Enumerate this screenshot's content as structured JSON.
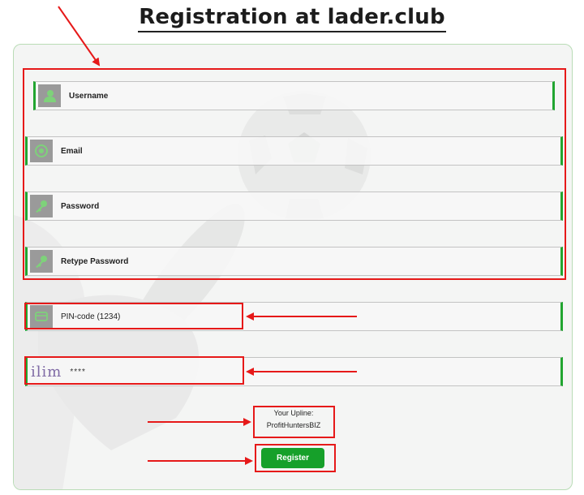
{
  "page": {
    "title": "Registration at lader.club"
  },
  "form": {
    "username": {
      "placeholder": "Username",
      "icon": "user-icon"
    },
    "email": {
      "placeholder": "Email",
      "icon": "at-icon"
    },
    "password": {
      "placeholder": "Password",
      "icon": "key-icon"
    },
    "retype_password": {
      "placeholder": "Retype Password",
      "icon": "key-icon"
    },
    "pin": {
      "placeholder": "PIN-code (1234)",
      "icon": "card-icon"
    },
    "captcha": {
      "image_text": "ilim",
      "value": "****"
    }
  },
  "upline": {
    "label": "Your Upline:",
    "name": "ProfitHuntersBIZ"
  },
  "register_button": {
    "label": "Register"
  },
  "colors": {
    "accent": "#16a02a",
    "field_bar": "#21a530",
    "annotation": "#e61919",
    "icon_bg": "#9a9a9a",
    "icon_fg": "#7ed27a"
  }
}
